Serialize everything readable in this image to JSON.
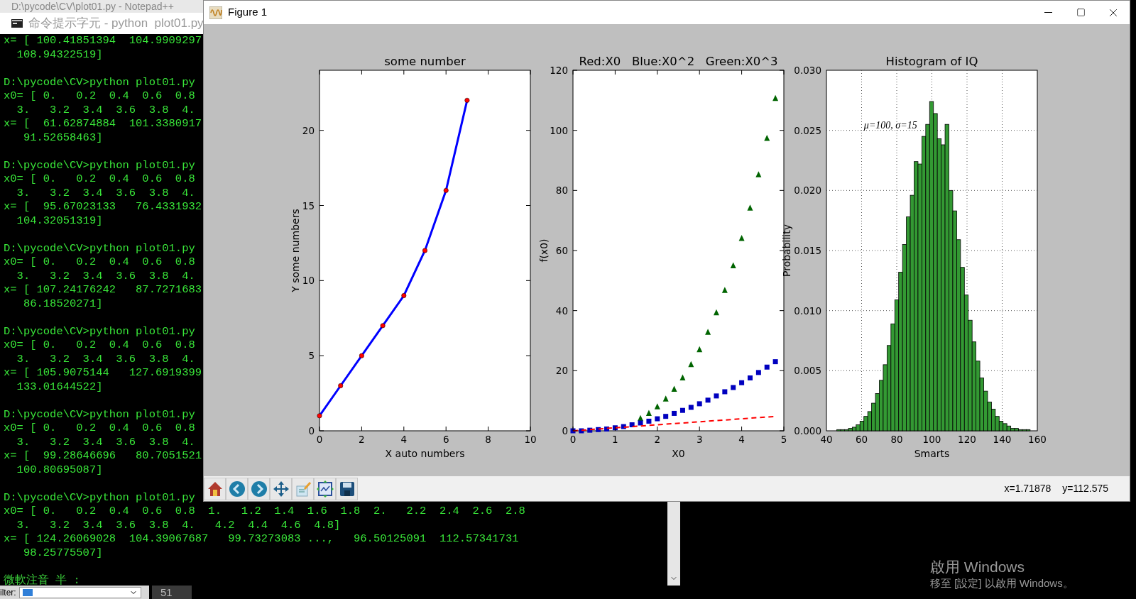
{
  "notepad_window": {
    "title": "D:\\pycode\\CV\\plot01.py - Notepad++"
  },
  "console": {
    "title": "命令提示字元 - python  plot01.py",
    "blocks": [
      [
        "x= [ 100.41851394  104.9909297",
        "  108.94322519]"
      ],
      [
        "D:\\pycode\\CV>python plot01.py",
        "x0= [ 0.   0.2  0.4  0.6  0.8",
        "  3.   3.2  3.4  3.6  3.8  4.",
        "x= [  61.62874884  101.3380917",
        "   91.52658463]"
      ],
      [
        "D:\\pycode\\CV>python plot01.py",
        "x0= [ 0.   0.2  0.4  0.6  0.8",
        "  3.   3.2  3.4  3.6  3.8  4.",
        "x= [  95.67023133   76.4331932",
        "  104.32051319]"
      ],
      [
        "D:\\pycode\\CV>python plot01.py",
        "x0= [ 0.   0.2  0.4  0.6  0.8",
        "  3.   3.2  3.4  3.6  3.8  4.",
        "x= [ 107.24176242   87.7271683",
        "   86.18520271]"
      ],
      [
        "D:\\pycode\\CV>python plot01.py",
        "x0= [ 0.   0.2  0.4  0.6  0.8",
        "  3.   3.2  3.4  3.6  3.8  4.",
        "x= [ 105.9075144   127.6919399",
        "  133.01644522]"
      ],
      [
        "D:\\pycode\\CV>python plot01.py",
        "x0= [ 0.   0.2  0.4  0.6  0.8",
        "  3.   3.2  3.4  3.6  3.8  4.",
        "x= [  99.28646696   80.7051521",
        "  100.80695087]"
      ],
      [
        "D:\\pycode\\CV>python plot01.py",
        "x0= [ 0.   0.2  0.4  0.6  0.8  1.   1.2  1.4  1.6  1.8  2.   2.2  2.4  2.6  2.8",
        "  3.   3.2  3.4  3.6  3.8  4.   4.2  4.4  4.6  4.8]",
        "x= [ 124.26069028  104.39067687   99.73273083 ...,   96.50125091  112.57341731",
        "   98.25775507]"
      ]
    ],
    "ime_status": "微軟注音 半 :"
  },
  "figure_window": {
    "title": "Figure 1",
    "plots": [
      {
        "chart_data": {
          "type": "line",
          "title": "some number",
          "xlabel": "X auto numbers",
          "ylabel": "Y some numbers",
          "x": [
            0,
            1,
            2,
            3,
            4,
            5,
            6,
            7
          ],
          "xlim": [
            0,
            10
          ],
          "ylim": [
            0,
            24
          ],
          "xticks": [
            0,
            2,
            4,
            6,
            8,
            10
          ],
          "yticks": [
            0,
            5,
            10,
            15,
            20
          ],
          "series": [
            {
              "color": "#0000ff",
              "marker": "circle",
              "values": [
                1,
                3,
                5,
                7,
                9,
                12,
                16,
                22
              ]
            }
          ]
        }
      },
      {
        "chart_data": {
          "type": "line",
          "title": "Red:X0   Blue:X0^2   Green:X0^3",
          "xlabel": "X0",
          "ylabel": "f(x0)",
          "x": [
            0,
            0.2,
            0.4,
            0.6,
            0.8,
            1,
            1.2,
            1.4,
            1.6,
            1.8,
            2,
            2.2,
            2.4,
            2.6,
            2.8,
            3,
            3.2,
            3.4,
            3.6,
            3.8,
            4,
            4.2,
            4.4,
            4.6,
            4.8
          ],
          "xlim": [
            0,
            5
          ],
          "ylim": [
            0,
            120
          ],
          "xticks": [
            0,
            1,
            2,
            3,
            4,
            5
          ],
          "yticks": [
            0,
            20,
            40,
            60,
            80,
            100,
            120
          ],
          "series": [
            {
              "color": "#ff0000",
              "line_style": "dashed",
              "values": [
                0,
                0.2,
                0.4,
                0.6,
                0.8,
                1,
                1.2,
                1.4,
                1.6,
                1.8,
                2,
                2.2,
                2.4,
                2.6,
                2.8,
                3,
                3.2,
                3.4,
                3.6,
                3.8,
                4,
                4.2,
                4.4,
                4.6,
                4.8
              ]
            },
            {
              "color": "#0000bf",
              "type": "scatter",
              "marker": "square",
              "values": [
                0,
                0,
                0.2,
                0.4,
                0.6,
                1,
                1.4,
                2,
                2.6,
                3.2,
                4,
                4.8,
                5.8,
                6.8,
                7.8,
                9,
                10.2,
                11.6,
                13,
                14.4,
                16,
                17.6,
                19.4,
                21.2,
                23
              ]
            },
            {
              "color": "#006400",
              "type": "scatter",
              "marker": "triangle",
              "values": [
                null,
                null,
                null,
                null,
                null,
                null,
                null,
                null,
                4.1,
                5.8,
                8,
                10.6,
                13.8,
                17.6,
                22,
                27,
                32.8,
                39.3,
                46.7,
                54.9,
                64,
                74.1,
                85.2,
                97.3,
                110.6
              ]
            }
          ]
        }
      },
      {
        "chart_data": {
          "type": "bar",
          "title": "Histogram of IQ",
          "xlabel": "Smarts",
          "ylabel": "Probability",
          "grid": true,
          "x": [
            47,
            49.2,
            51.4,
            53.6,
            55.8,
            58,
            60.2,
            62.4,
            64.6,
            66.8,
            69,
            71.2,
            73.4,
            75.6,
            77.8,
            80,
            82.2,
            84.4,
            86.6,
            88.8,
            91,
            93.2,
            95.4,
            97.6,
            99.8,
            102,
            104.2,
            106.4,
            108.6,
            110.8,
            113,
            115.2,
            117.4,
            119.6,
            121.8,
            124,
            126.2,
            128.4,
            130.6,
            132.8,
            135,
            137.2,
            139.4,
            141.6,
            143.8,
            146,
            148.2,
            150.4,
            152.6,
            154.8
          ],
          "xlim": [
            40,
            160
          ],
          "ylim": [
            0,
            0.03
          ],
          "xticks": [
            40,
            60,
            80,
            100,
            120,
            140,
            160
          ],
          "yticks": [
            {
              "value": 0,
              "label": "0.000"
            },
            {
              "value": 0.005,
              "label": "0.005"
            },
            {
              "value": 0.01,
              "label": "0.010"
            },
            {
              "value": 0.015,
              "label": "0.015"
            },
            {
              "value": 0.02,
              "label": "0.020"
            },
            {
              "value": 0.025,
              "label": "0.025"
            },
            {
              "value": 0.03,
              "label": "0.030"
            }
          ],
          "series": [
            {
              "color": "#339933",
              "values": [
                0.0001,
                0.0001,
                0.0001,
                0.0002,
                0.0003,
                0.0005,
                0.0008,
                0.0012,
                0.0016,
                0.0023,
                0.0031,
                0.0042,
                0.0055,
                0.0071,
                0.0089,
                0.0109,
                0.0132,
                0.0155,
                0.0178,
                0.0196,
                0.0224,
                0.0222,
                0.0245,
                0.0255,
                0.0274,
                0.0264,
                0.0243,
                0.0238,
                0.0255,
                0.02,
                0.0183,
                0.0159,
                0.0136,
                0.0113,
                0.0092,
                0.0074,
                0.0058,
                0.0044,
                0.0033,
                0.0024,
                0.0018,
                0.0012,
                0.0008,
                0.0006,
                0.0004,
                0.0002,
                0.0002,
                0.0001,
                0.0001,
                0.0001
              ]
            }
          ],
          "annotations": [
            "μ=100, σ=15"
          ]
        }
      }
    ],
    "toolbar": [
      {
        "kind": "home"
      },
      {
        "kind": "back"
      },
      {
        "kind": "forward"
      },
      {
        "kind": "pan"
      },
      {
        "kind": "edit"
      },
      {
        "kind": "subplots"
      },
      {
        "kind": "save"
      }
    ],
    "coordinates": {
      "x": "x=1.71878",
      "y": "y=112.575"
    }
  },
  "bottom_bar": {
    "filter_label": "ilter:",
    "count": "51"
  },
  "activation_notice": {
    "title": "啟用 Windows",
    "message": "移至 [設定] 以啟用 Windows。"
  }
}
